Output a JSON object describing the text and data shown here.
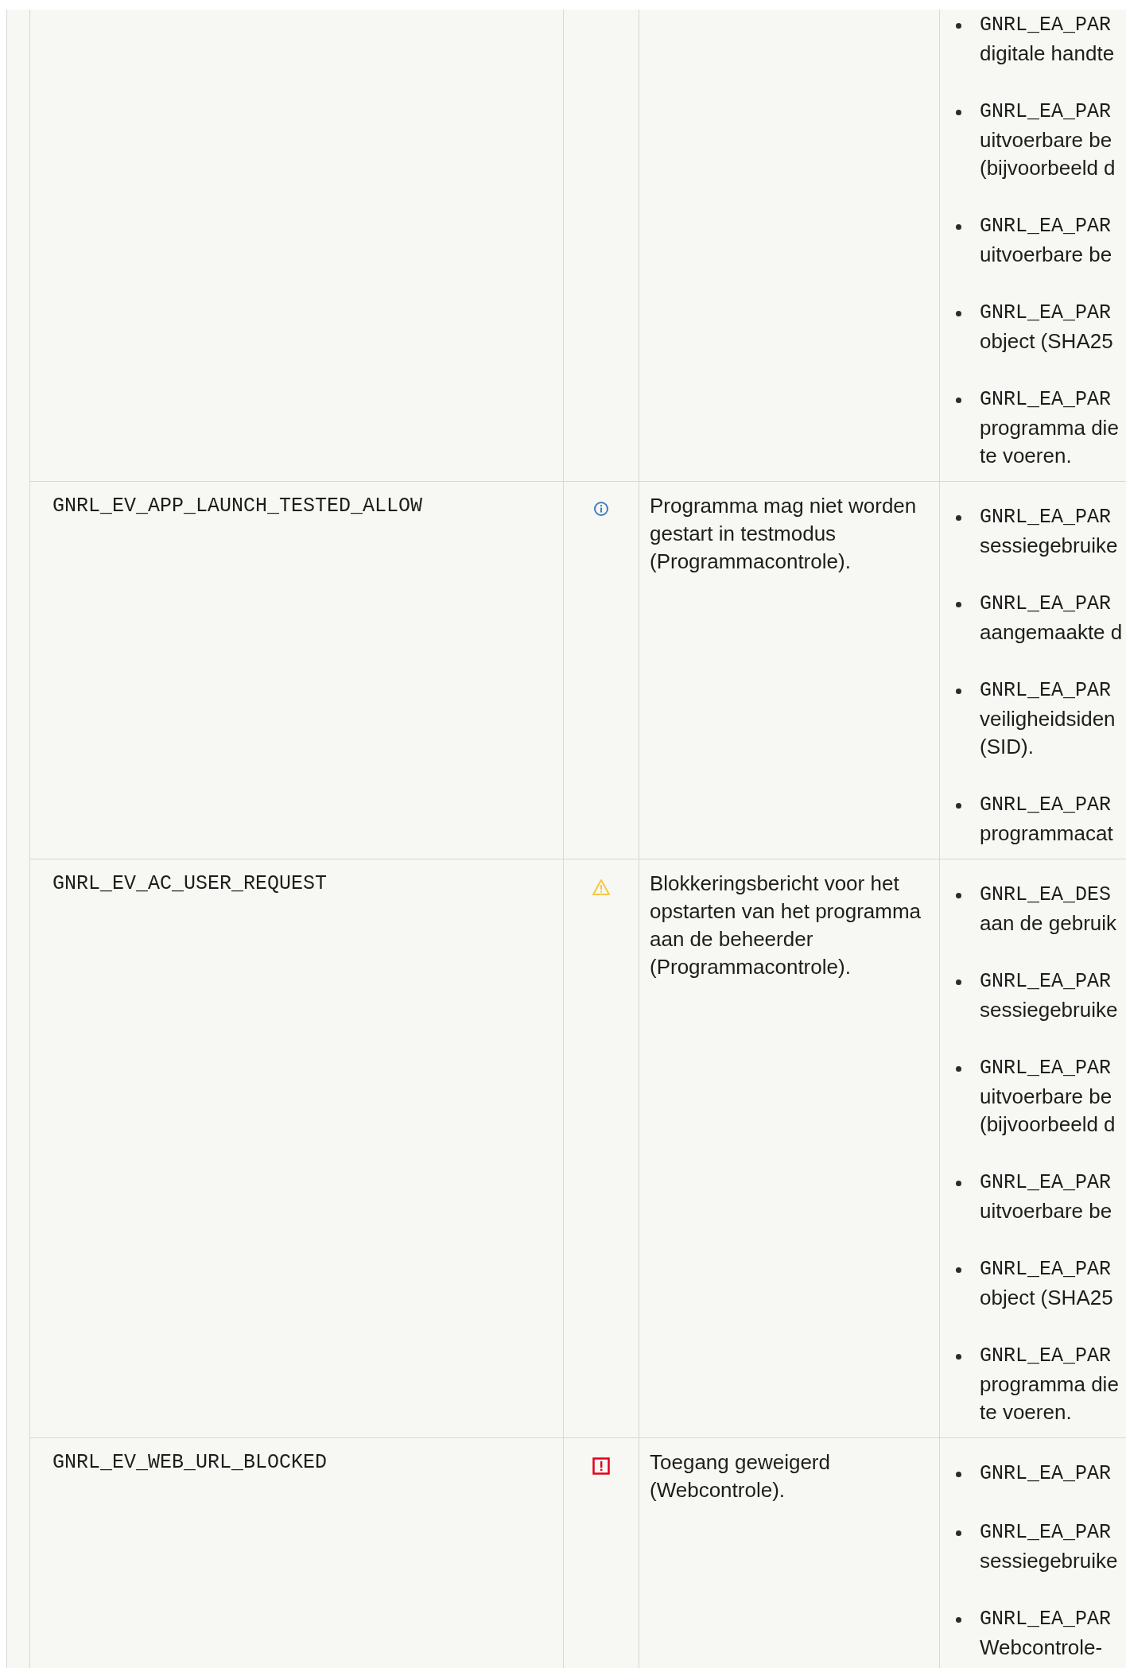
{
  "table": {
    "rows": [
      {
        "details": [
          {
            "code": "GNRL_EA_PAR",
            "lines": [
              "digitale handte"
            ]
          },
          {
            "code": "GNRL_EA_PAR",
            "lines": [
              "uitvoerbare be",
              "(bijvoorbeeld d"
            ]
          },
          {
            "code": "GNRL_EA_PAR",
            "lines": [
              "uitvoerbare be"
            ]
          },
          {
            "code": "GNRL_EA_PAR",
            "lines": [
              "object (SHA25"
            ]
          },
          {
            "code": "GNRL_EA_PAR",
            "lines": [
              "programma die",
              "te voeren."
            ]
          }
        ]
      },
      {
        "event": "GNRL_EV_APP_LAUNCH_TESTED_ALLOW",
        "kind": "info",
        "description": "Programma mag niet worden gestart in testmodus (Programmacontrole).",
        "details": [
          {
            "code": "GNRL_EA_PAR",
            "lines": [
              "sessiegebruike"
            ]
          },
          {
            "code": "GNRL_EA_PAR",
            "lines": [
              "aangemaakte d"
            ]
          },
          {
            "code": "GNRL_EA_PAR",
            "lines": [
              "veiligheidsiden",
              "(SID)."
            ]
          },
          {
            "code": "GNRL_EA_PAR",
            "lines": [
              "programmacat"
            ]
          }
        ]
      },
      {
        "event": "GNRL_EV_AC_USER_REQUEST",
        "kind": "warning",
        "description": "Blokkeringsbericht voor het opstarten van het programma aan de beheerder (Programmacontrole).",
        "details": [
          {
            "code": "GNRL_EA_DES",
            "lines": [
              "aan de gebruik"
            ]
          },
          {
            "code": "GNRL_EA_PAR",
            "lines": [
              "sessiegebruike"
            ]
          },
          {
            "code": "GNRL_EA_PAR",
            "lines": [
              "uitvoerbare be",
              "(bijvoorbeeld d"
            ]
          },
          {
            "code": "GNRL_EA_PAR",
            "lines": [
              "uitvoerbare be"
            ]
          },
          {
            "code": "GNRL_EA_PAR",
            "lines": [
              "object (SHA25"
            ]
          },
          {
            "code": "GNRL_EA_PAR",
            "lines": [
              "programma die",
              "te voeren."
            ]
          }
        ]
      },
      {
        "event": "GNRL_EV_WEB_URL_BLOCKED",
        "kind": "critical",
        "description": "Toegang geweigerd (Webcontrole).",
        "details": [
          {
            "code": "GNRL_EA_PAR"
          },
          {
            "code": "GNRL_EA_PAR",
            "lines": [
              "sessiegebruike"
            ]
          },
          {
            "code": "GNRL_EA_PAR",
            "lines": [
              "Webcontrole-"
            ]
          }
        ]
      }
    ]
  }
}
